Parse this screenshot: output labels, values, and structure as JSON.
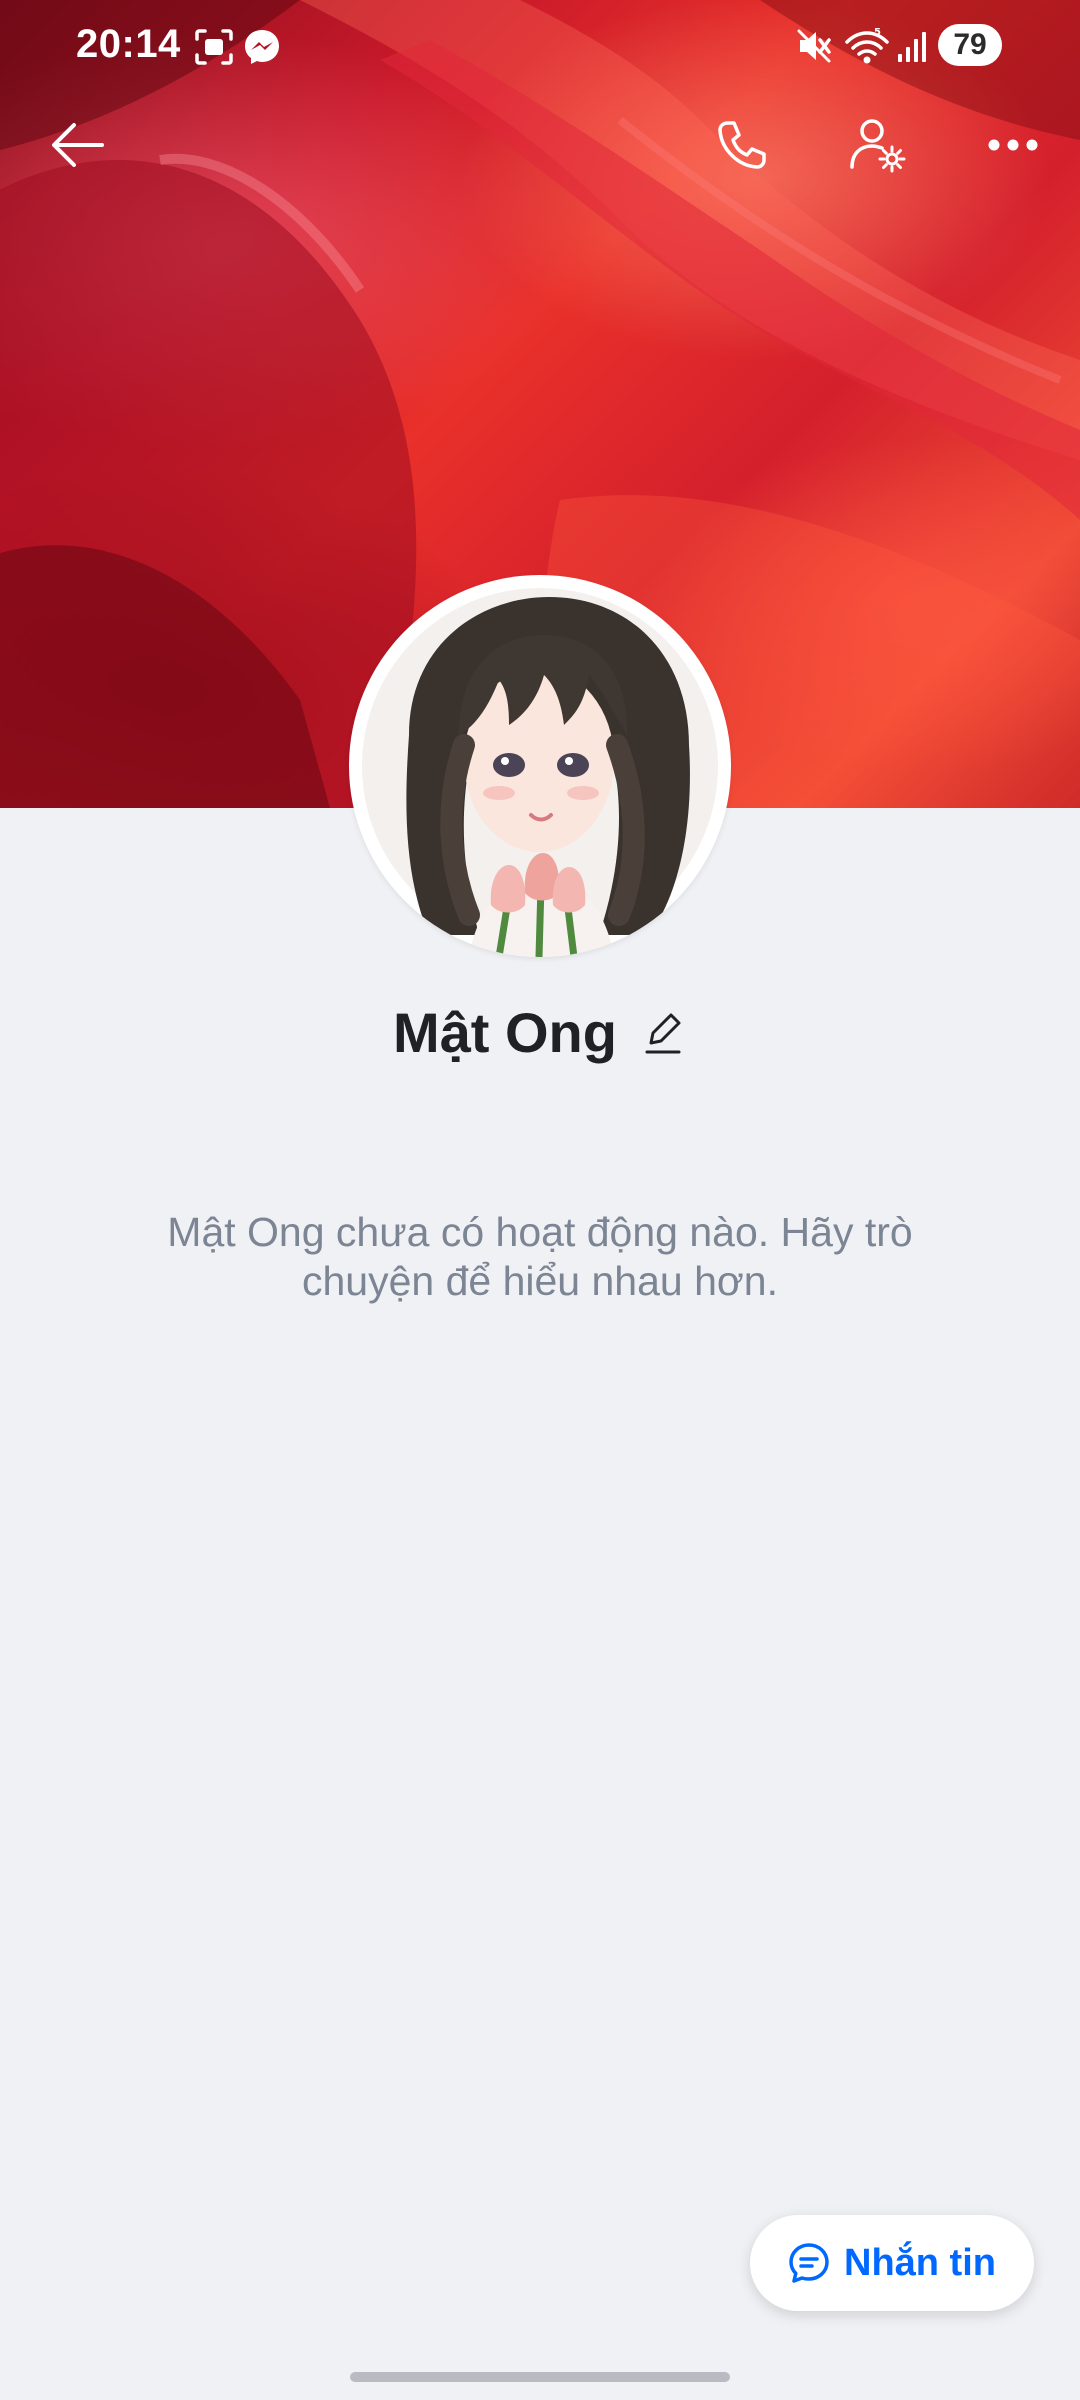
{
  "status_bar": {
    "time": "20:14",
    "battery_level": "79",
    "icons": [
      "screenshot-icon",
      "messenger-icon",
      "mute-icon",
      "wifi-icon",
      "signal-icon",
      "battery-icon"
    ]
  },
  "top_nav": {
    "icons": [
      "back-arrow-icon",
      "phone-icon",
      "user-settings-icon",
      "more-icon"
    ]
  },
  "profile": {
    "name": "Mật Ong",
    "empty_message": "Mật Ong chưa có hoạt động nào. Hãy trò chuyện để hiểu nhau hơn."
  },
  "message_button": {
    "label": "Nhắn tin",
    "icon": "chat-bubble-icon"
  },
  "colors": {
    "accent": "#0068ff",
    "background": "#f0f1f5",
    "cover": "#d8202c",
    "secondary_text": "#7c8594"
  }
}
